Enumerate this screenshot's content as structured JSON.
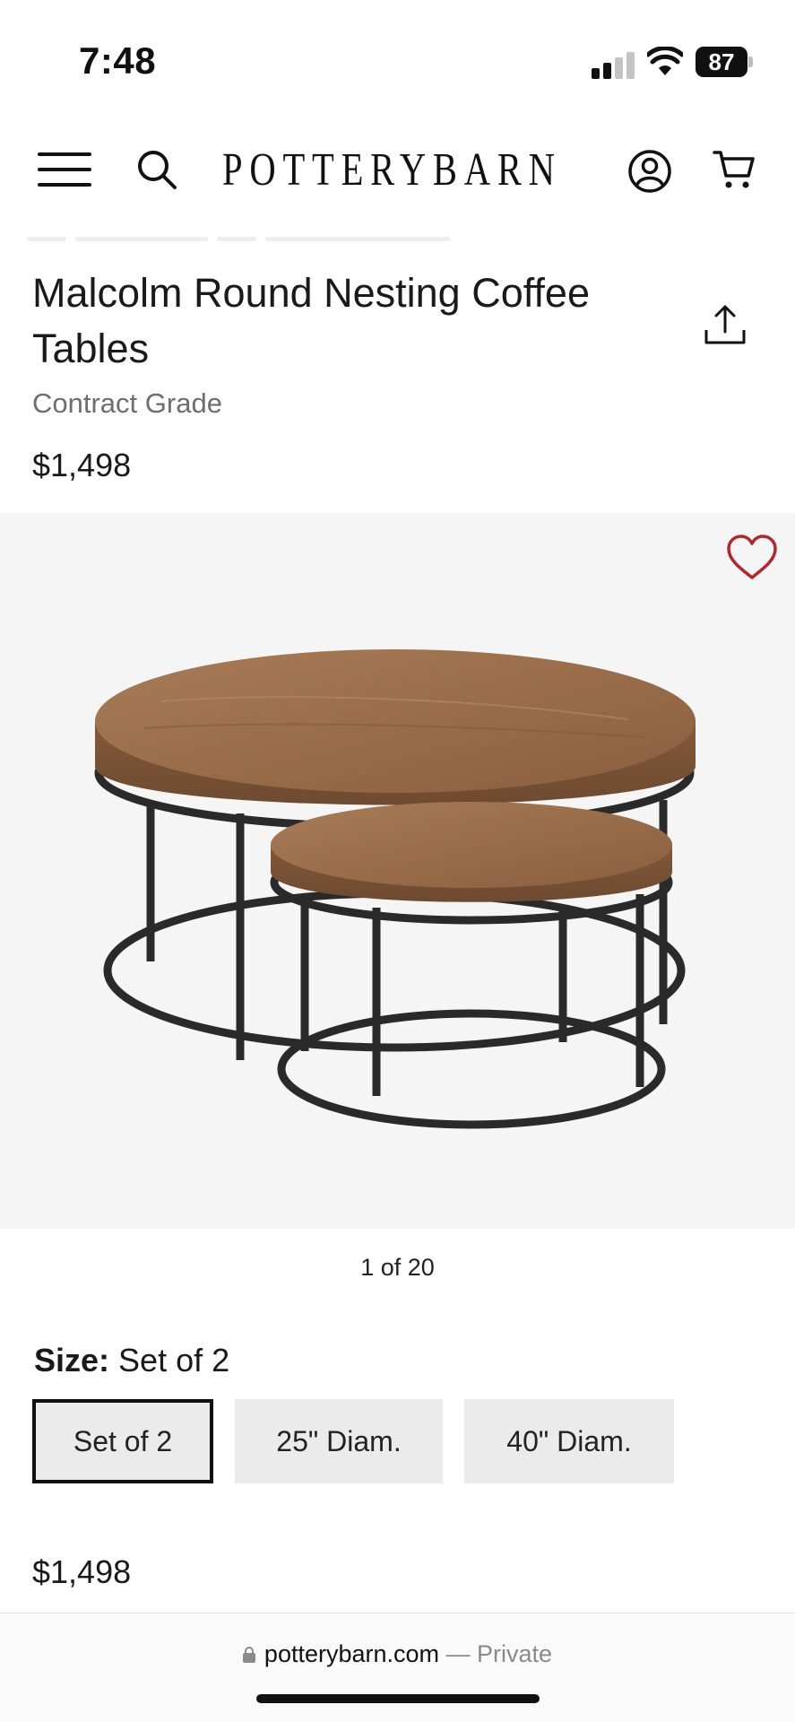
{
  "status_bar": {
    "time": "7:48",
    "battery": "87"
  },
  "header": {
    "logo_text": "POTTERYBARN",
    "icons": [
      "menu-icon",
      "search-icon",
      "account-icon",
      "cart-icon"
    ]
  },
  "product": {
    "title": "Malcolm Round Nesting Coffee Tables",
    "subtitle": "Contract Grade",
    "price": "$1,498"
  },
  "gallery": {
    "counter": "1 of 20",
    "favorite_color": "#b3272c",
    "background": "#f5f5f5"
  },
  "size": {
    "label": "Size:",
    "selected_value": "Set of 2",
    "options": [
      {
        "label": "Set of 2",
        "selected": true
      },
      {
        "label": "25\" Diam.",
        "selected": false
      },
      {
        "label": "40\" Diam.",
        "selected": false
      }
    ]
  },
  "bottom_price": "$1,498",
  "browser": {
    "domain": "potterybarn.com",
    "separator": " — ",
    "mode": "Private"
  }
}
